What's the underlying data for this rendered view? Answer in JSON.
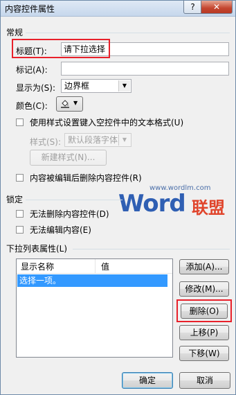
{
  "window": {
    "title": "内容控件属性",
    "help_label": "?",
    "close_label": "✕"
  },
  "general": {
    "heading": "常规",
    "title_label": "标题(T):",
    "title_value": "请下拉选择",
    "tag_label": "标记(A):",
    "tag_value": "",
    "show_as_label": "显示为(S):",
    "show_as_value": "边界框",
    "color_label": "颜色(C):",
    "use_style_label": "使用样式设置键入空控件中的文本格式(U)",
    "style_label": "样式(S):",
    "style_value": "默认段落字体",
    "new_style_label": "新建样式(N)...",
    "remove_label": "内容被编辑后删除内容控件(R)"
  },
  "locking": {
    "heading": "锁定",
    "cannot_delete_label": "无法删除内容控件(D)",
    "cannot_edit_label": "无法编辑内容(E)"
  },
  "watermark": {
    "url": "www.wordlm.com",
    "word": "Word",
    "cn": "联盟"
  },
  "dropdown_props": {
    "heading": "下拉列表属性(L)",
    "columns": [
      "显示名称",
      "值"
    ],
    "items": [
      {
        "display": "选择一项。",
        "value": ""
      }
    ],
    "buttons": {
      "add": "添加(A)...",
      "modify": "修改(M)...",
      "delete": "删除(O)",
      "move_up": "上移(P)",
      "move_down": "下移(W)"
    }
  },
  "footer": {
    "ok_label": "确定",
    "cancel_label": "取消"
  },
  "colors": {
    "highlight": "#e8202a",
    "selection": "#3399ff"
  }
}
